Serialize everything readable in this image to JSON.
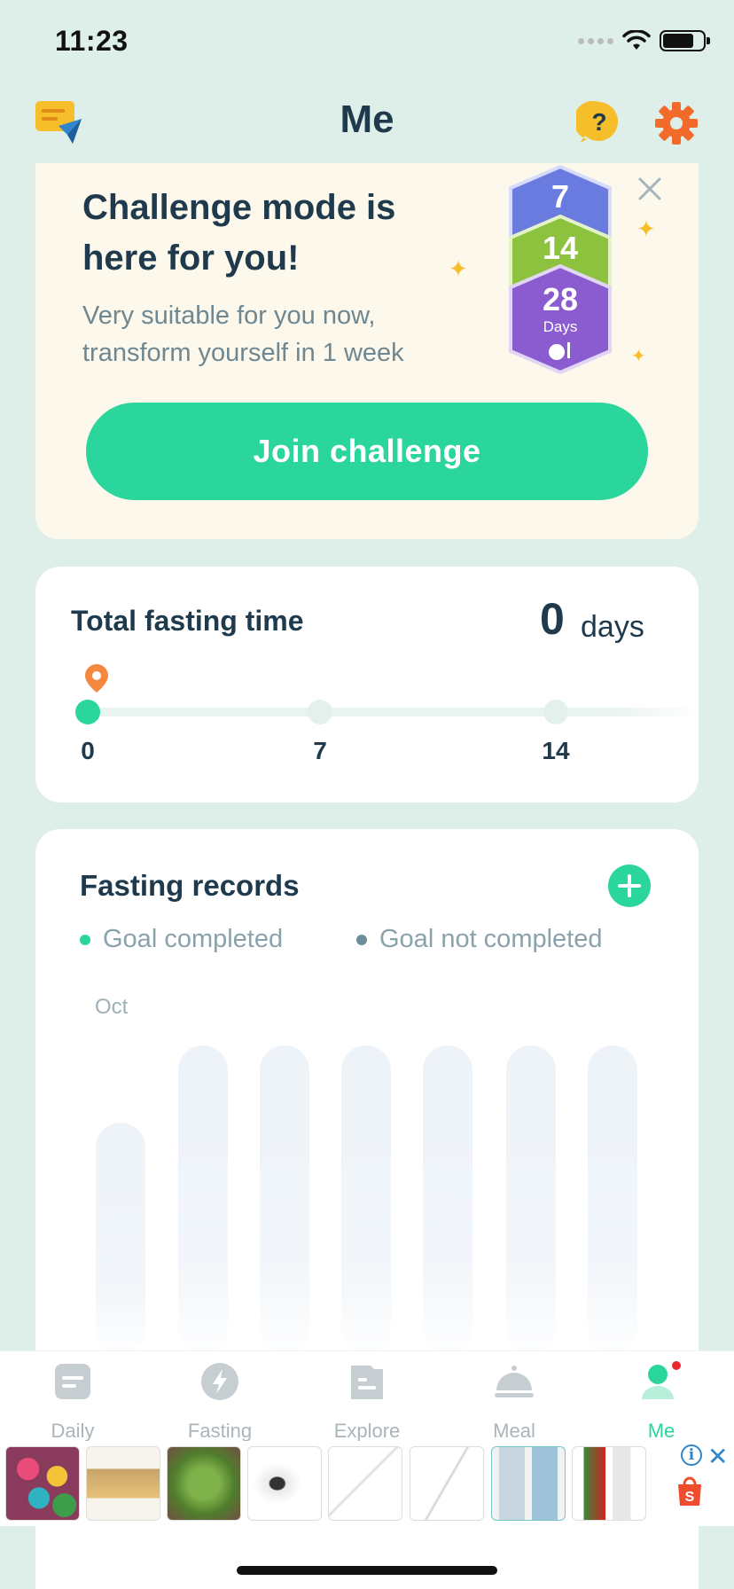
{
  "status_bar": {
    "time": "11:23"
  },
  "header": {
    "title": "Me"
  },
  "challenge": {
    "title": "Challenge mode is here for you!",
    "subtitle": "Very suitable for you now, transform yourself in 1 week",
    "button_label": "Join challenge",
    "badges": [
      "7",
      "14",
      "28"
    ],
    "badge_unit": "Days"
  },
  "total_fasting": {
    "label": "Total fasting time",
    "value": "0",
    "unit": "days",
    "ticks": [
      "0",
      "7",
      "14"
    ],
    "progress_days": 0
  },
  "records": {
    "title": "Fasting records",
    "legend_completed": "Goal completed",
    "legend_not_completed": "Goal not completed",
    "month": "Oct",
    "colors": {
      "completed": "#2bd69c",
      "not_completed": "#6f8c9a"
    }
  },
  "tabs": [
    {
      "label": "Daily",
      "icon": "daily-icon"
    },
    {
      "label": "Fasting",
      "icon": "fasting-icon"
    },
    {
      "label": "Explore",
      "icon": "explore-icon"
    },
    {
      "label": "Meal",
      "icon": "meal-icon"
    },
    {
      "label": "Me",
      "icon": "me-icon",
      "active": true
    }
  ],
  "colors": {
    "accent": "#2bd69c",
    "title": "#1e3a4c",
    "background": "#deefe9",
    "card_cream": "#fcf8ec"
  }
}
